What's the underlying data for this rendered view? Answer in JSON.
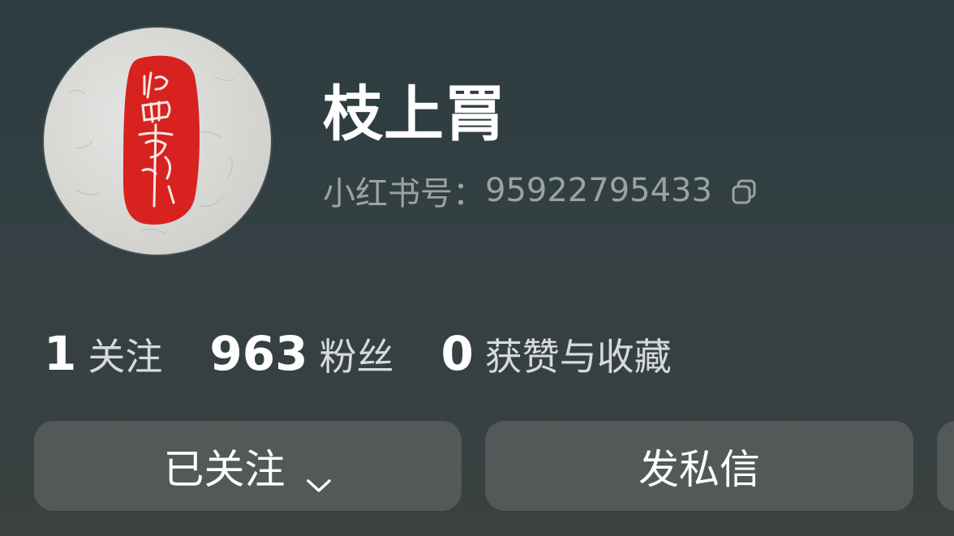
{
  "profile": {
    "name": "枝上罥",
    "id_label": "小红书号：",
    "id_value": "95922795433",
    "copy_icon": "copy-icon",
    "avatar_icon": "red-seal-avatar"
  },
  "stats": [
    {
      "value": "1",
      "label": "关注"
    },
    {
      "value": "963",
      "label": "粉丝"
    },
    {
      "value": "0",
      "label": "获赞与收藏"
    }
  ],
  "buttons": {
    "following_label": "已关注",
    "following_icon": "chevron-down-icon",
    "message_label": "发私信"
  },
  "colors": {
    "background_top": "#2c3c40",
    "background_bottom": "#3a4140",
    "button_bg": "#535858",
    "seal_red": "#d8221f",
    "muted_text": "#9aa3a4"
  }
}
